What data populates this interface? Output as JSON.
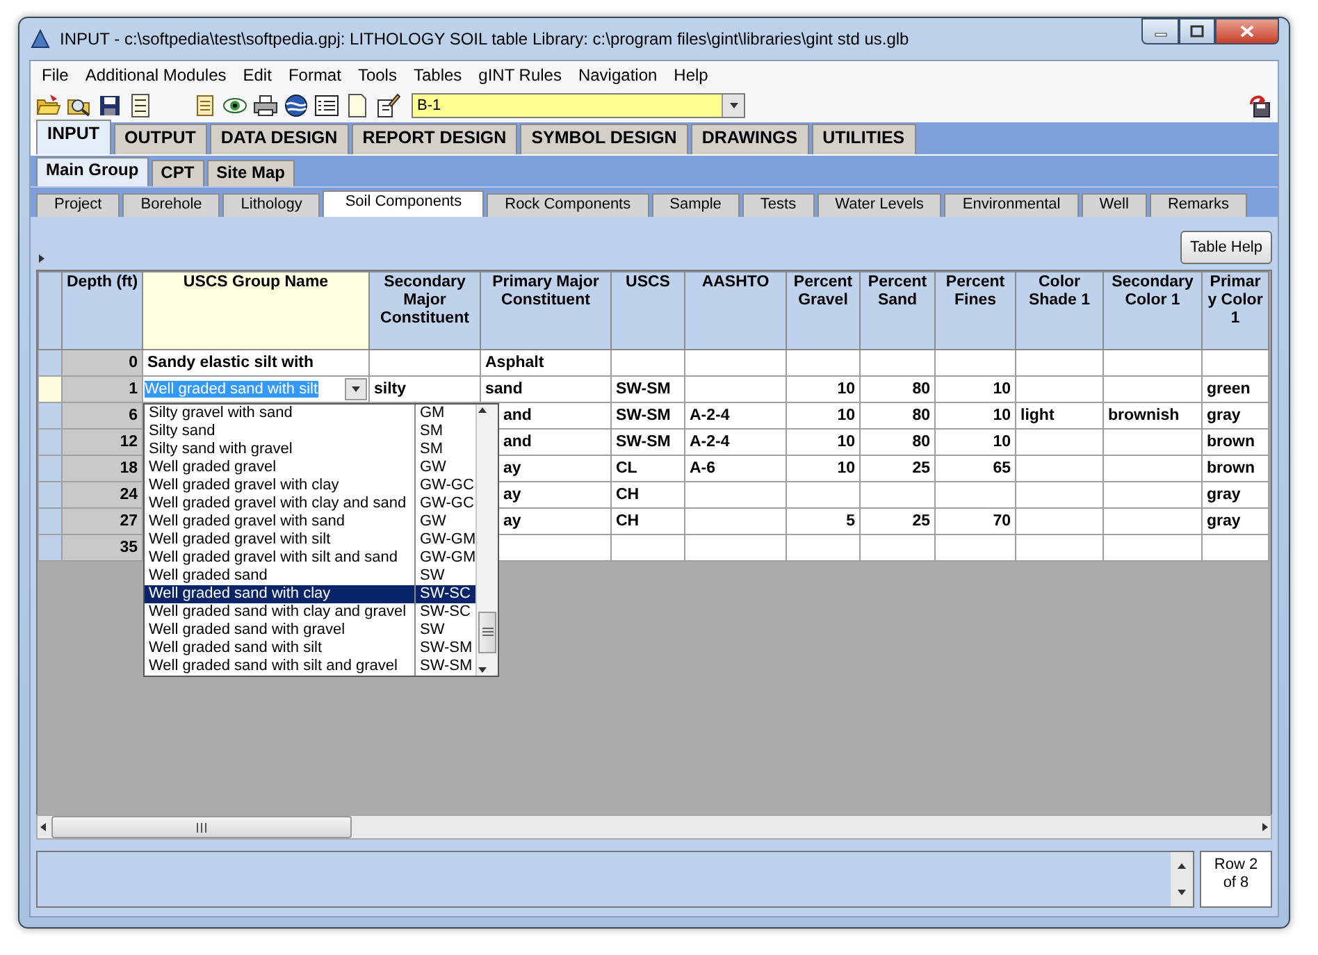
{
  "window": {
    "title": "INPUT -  c:\\softpedia\\test\\softpedia.gpj: LITHOLOGY SOIL table  Library: c:\\program files\\gint\\libraries\\gint std us.glb"
  },
  "menu": [
    "File",
    "Additional Modules",
    "Edit",
    "Format",
    "Tools",
    "Tables",
    "gINT Rules",
    "Navigation",
    "Help"
  ],
  "toolbar": {
    "record_select": {
      "value": "B-1"
    }
  },
  "main_tabs": [
    {
      "label": "INPUT",
      "selected": true
    },
    {
      "label": "OUTPUT",
      "selected": false
    },
    {
      "label": "DATA DESIGN",
      "selected": false
    },
    {
      "label": "REPORT DESIGN",
      "selected": false
    },
    {
      "label": "SYMBOL DESIGN",
      "selected": false
    },
    {
      "label": "DRAWINGS",
      "selected": false
    },
    {
      "label": "UTILITIES",
      "selected": false
    }
  ],
  "group_tabs": [
    {
      "label": "Main Group",
      "selected": true
    },
    {
      "label": "CPT",
      "selected": false
    },
    {
      "label": "Site Map",
      "selected": false
    }
  ],
  "table_tabs": [
    {
      "label": "Project",
      "selected": false
    },
    {
      "label": "Borehole",
      "selected": false
    },
    {
      "label": "Lithology",
      "selected": false
    },
    {
      "label": "Soil Components",
      "selected": true
    },
    {
      "label": "Rock Components",
      "selected": false
    },
    {
      "label": "Sample",
      "selected": false
    },
    {
      "label": "Tests",
      "selected": false
    },
    {
      "label": "Water Levels",
      "selected": false
    },
    {
      "label": "Environmental",
      "selected": false
    },
    {
      "label": "Well",
      "selected": false
    },
    {
      "label": "Remarks",
      "selected": false
    }
  ],
  "table_help_button": "Table Help",
  "table": {
    "columns": [
      {
        "label": "Depth (ft)",
        "selected": false
      },
      {
        "label": "USCS Group Name",
        "selected": true
      },
      {
        "label": "Secondary Major Constituent",
        "selected": false
      },
      {
        "label": "Primary Major Constituent",
        "selected": false
      },
      {
        "label": "USCS",
        "selected": false
      },
      {
        "label": "AASHTO",
        "selected": false
      },
      {
        "label": "Percent Gravel",
        "selected": false
      },
      {
        "label": "Percent Sand",
        "selected": false
      },
      {
        "label": "Percent Fines",
        "selected": false
      },
      {
        "label": "Color Shade 1",
        "selected": false
      },
      {
        "label": "Secondary Color 1",
        "selected": false
      },
      {
        "label": "Primar y Color 1",
        "selected": false
      }
    ],
    "rows": [
      {
        "selected": false,
        "cells": {
          "depth": "0",
          "uscs_group_name": "Sandy elastic silt with",
          "primary_major_constituent": "Asphalt"
        }
      },
      {
        "selected": true,
        "cells": {
          "depth": "1",
          "uscs_group_name": "Well graded sand with silt",
          "secondary_major_constituent": "silty",
          "primary_major_constituent": "sand",
          "uscs": "SW-SM",
          "percent_gravel": "10",
          "percent_sand": "80",
          "percent_fines": "10",
          "primary_color_1": "green"
        }
      },
      {
        "selected": false,
        "cells": {
          "depth": "6",
          "primary_major_constituent": "and",
          "uscs": "SW-SM",
          "aashto": "A-2-4",
          "percent_gravel": "10",
          "percent_sand": "80",
          "percent_fines": "10",
          "color_shade_1": "light",
          "secondary_color_1": "brownish",
          "primary_color_1": "gray"
        }
      },
      {
        "selected": false,
        "cells": {
          "depth": "12",
          "primary_major_constituent": "and",
          "uscs": "SW-SM",
          "aashto": "A-2-4",
          "percent_gravel": "10",
          "percent_sand": "80",
          "percent_fines": "10",
          "primary_color_1": "brown"
        }
      },
      {
        "selected": false,
        "cells": {
          "depth": "18",
          "primary_major_constituent": "ay",
          "uscs": "CL",
          "aashto": "A-6",
          "percent_gravel": "10",
          "percent_sand": "25",
          "percent_fines": "65",
          "primary_color_1": "brown"
        }
      },
      {
        "selected": false,
        "cells": {
          "depth": "24",
          "primary_major_constituent": "ay",
          "uscs": "CH",
          "primary_color_1": "gray"
        }
      },
      {
        "selected": false,
        "cells": {
          "depth": "27",
          "primary_major_constituent": "ay",
          "uscs": "CH",
          "percent_gravel": "5",
          "percent_sand": "25",
          "percent_fines": "70",
          "primary_color_1": "gray"
        }
      },
      {
        "selected": false,
        "cells": {
          "depth": "35"
        }
      }
    ]
  },
  "dropdown": {
    "items": [
      {
        "name": "Silty gravel with sand",
        "code": "GM",
        "selected": false
      },
      {
        "name": "Silty sand",
        "code": "SM",
        "selected": false
      },
      {
        "name": "Silty sand with gravel",
        "code": "SM",
        "selected": false
      },
      {
        "name": "Well graded gravel",
        "code": "GW",
        "selected": false
      },
      {
        "name": "Well graded gravel with clay",
        "code": "GW-GC",
        "selected": false
      },
      {
        "name": "Well graded gravel with clay and sand",
        "code": "GW-GC",
        "selected": false
      },
      {
        "name": "Well graded gravel with sand",
        "code": "GW",
        "selected": false
      },
      {
        "name": "Well graded gravel with silt",
        "code": "GW-GM",
        "selected": false
      },
      {
        "name": "Well graded gravel with silt and sand",
        "code": "GW-GM",
        "selected": false
      },
      {
        "name": "Well graded sand",
        "code": "SW",
        "selected": false
      },
      {
        "name": "Well graded sand with clay",
        "code": "SW-SC",
        "selected": true
      },
      {
        "name": "Well graded sand with clay and gravel",
        "code": "SW-SC",
        "selected": false
      },
      {
        "name": "Well graded sand with gravel",
        "code": "SW",
        "selected": false
      },
      {
        "name": "Well graded sand with silt",
        "code": "SW-SM",
        "selected": false
      },
      {
        "name": "Well graded sand with silt and gravel",
        "code": "SW-SM",
        "selected": false
      }
    ]
  },
  "status_bar": {
    "row_indicator": "Row 2 of 8"
  }
}
